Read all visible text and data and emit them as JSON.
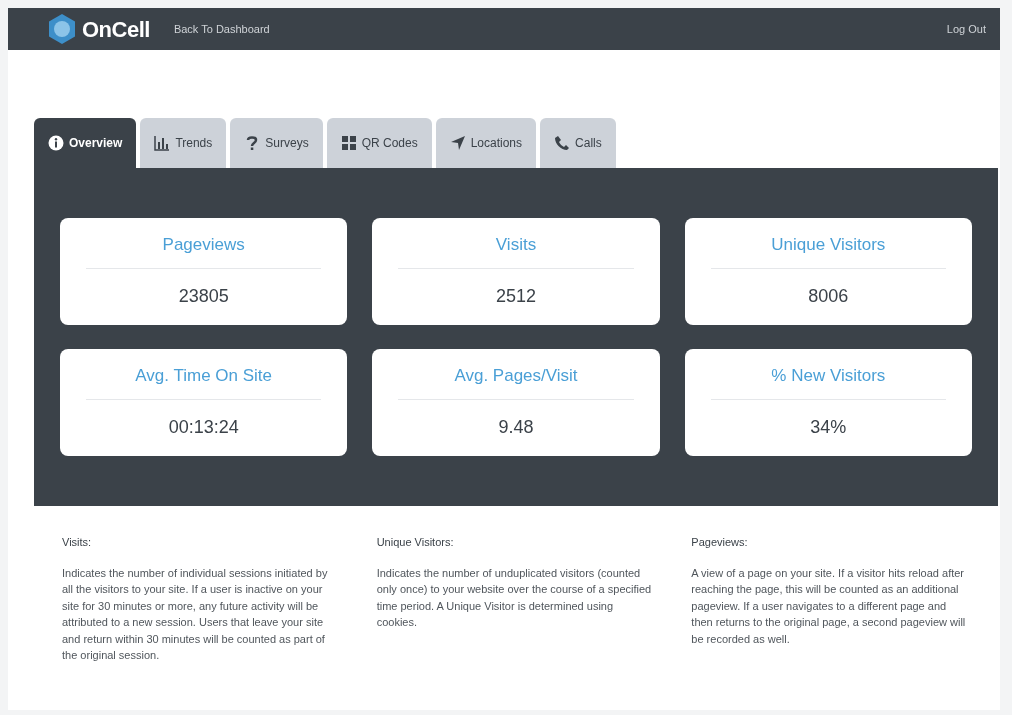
{
  "header": {
    "brand": "OnCell",
    "back_link": "Back To Dashboard",
    "logout": "Log Out"
  },
  "tabs": [
    {
      "label": "Overview",
      "selected": true
    },
    {
      "label": "Trends",
      "selected": false
    },
    {
      "label": "Surveys",
      "selected": false
    },
    {
      "label": "QR Codes",
      "selected": false
    },
    {
      "label": "Locations",
      "selected": false
    },
    {
      "label": "Calls",
      "selected": false
    }
  ],
  "stats": [
    {
      "label": "Pageviews",
      "value": "23805"
    },
    {
      "label": "Visits",
      "value": "2512"
    },
    {
      "label": "Unique Visitors",
      "value": "8006"
    },
    {
      "label": "Avg. Time On Site",
      "value": "00:13:24"
    },
    {
      "label": "Avg. Pages/Visit",
      "value": "9.48"
    },
    {
      "label": "% New Visitors",
      "value": "34%"
    }
  ],
  "definitions": [
    {
      "term": "Visits:",
      "text": "Indicates the number of individual sessions initiated by all the visitors to your site. If a user is inactive on your site for 30 minutes or more, any future activity will be attributed to a new session. Users that leave your site and return within 30 minutes will be counted as part of the original session."
    },
    {
      "term": "Unique Visitors:",
      "text": "Indicates the number of unduplicated visitors (counted only once) to your website over the course of a specified time period. A Unique Visitor is determined using cookies."
    },
    {
      "term": "Pageviews:",
      "text": "A view of a page on your site. If a visitor hits reload after reaching the page, this will be counted as an additional pageview. If a user navigates to a different page and then returns to the original page, a second pageview will be recorded as well."
    }
  ]
}
